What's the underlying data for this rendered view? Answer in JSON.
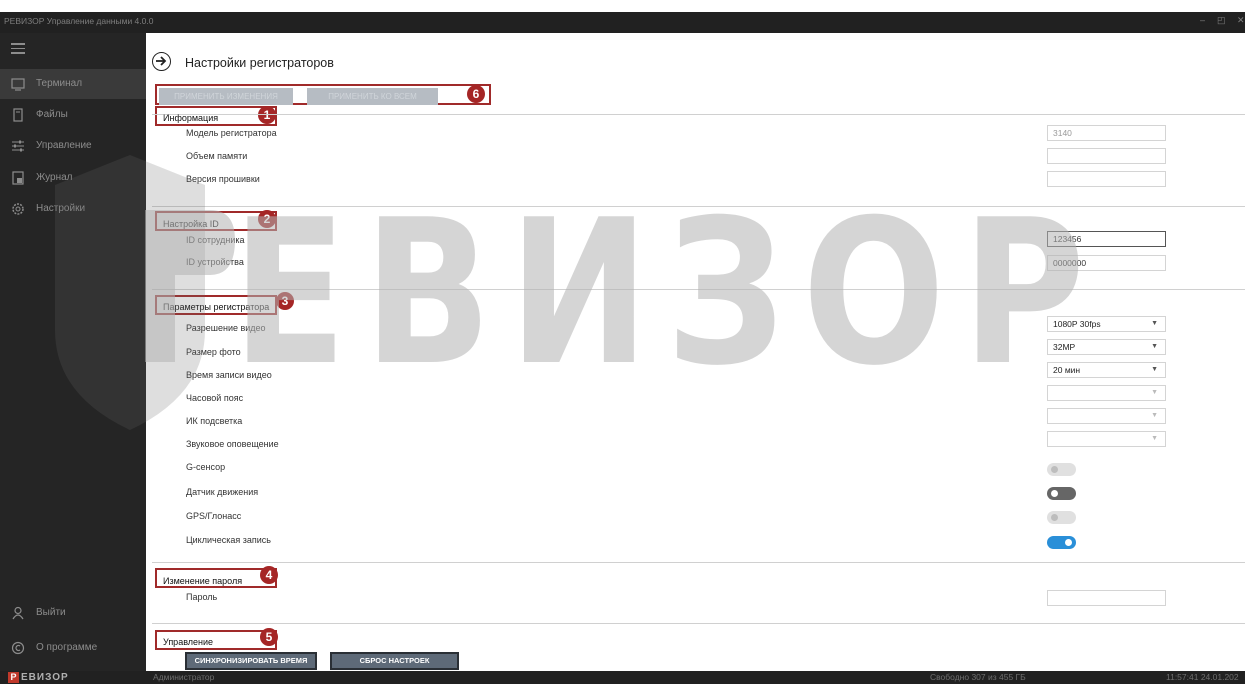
{
  "window": {
    "title": "РЕВИЗОР Управление данными 4.0.0",
    "controls": [
      "–",
      "◰",
      "✕"
    ]
  },
  "sidebar": {
    "items": [
      {
        "label": "Терминал",
        "icon": "terminal-icon"
      },
      {
        "label": "Файлы",
        "icon": "files-icon"
      },
      {
        "label": "Управление",
        "icon": "sliders-icon"
      },
      {
        "label": "Журнал",
        "icon": "journal-icon"
      },
      {
        "label": "Настройки",
        "icon": "gear-icon"
      }
    ],
    "bottom": [
      {
        "label": "Выйти",
        "icon": "user-icon"
      },
      {
        "label": "О программе",
        "icon": "copyright-icon"
      }
    ]
  },
  "page": {
    "title": "Настройки регистраторов"
  },
  "actions": {
    "apply": "ПРИМЕНИТЬ ИЗМЕНЕНИЯ",
    "apply_all": "ПРИМЕНИТЬ КО ВСЕМ"
  },
  "badges": [
    "1",
    "2",
    "3",
    "4",
    "5",
    "6"
  ],
  "info": {
    "title": "Информация",
    "model_label": "Модель регистратора",
    "model_value": "3140",
    "memory_label": "Объем памяти",
    "memory_value": "",
    "firmware_label": "Версия прошивки",
    "firmware_value": ""
  },
  "id_settings": {
    "title": "Настройка ID",
    "employee_label": "ID сотрудника",
    "employee_value": "123456",
    "device_label": "ID устройства",
    "device_value": "0000000"
  },
  "recorder_params": {
    "title": "Параметры регистратора",
    "video_res_label": "Разрешение видео",
    "video_res_value": "1080P 30fps",
    "photo_size_label": "Размер фото",
    "photo_size_value": "32MP",
    "rec_time_label": "Время записи видео",
    "rec_time_value": "20 мин",
    "timezone_label": "Часовой пояс",
    "timezone_value": "",
    "ir_label": "ИК подсветка",
    "ir_value": "",
    "sound_label": "Звуковое оповещение",
    "sound_value": "",
    "gsensor_label": "G-сенсор",
    "motion_label": "Датчик движения",
    "gps_label": "GPS/Глонасс",
    "cyclic_label": "Циклическая запись"
  },
  "toggles": {
    "gsensor": false,
    "motion": false,
    "gps": false,
    "cyclic": true
  },
  "password": {
    "title": "Изменение пароля",
    "label": "Пароль",
    "value": ""
  },
  "control": {
    "title": "Управление",
    "sync_time": "СИНХРОНИЗИРОВАТЬ ВРЕМЯ",
    "reset": "СБРОС НАСТРОЕК"
  },
  "status": {
    "logo_letter": "Р",
    "logo_text": "ЕВИЗОР",
    "user": "Администратор",
    "free_space": "Свободно 307 из 455 ГБ",
    "datetime": "11:57:41 24.01.202"
  },
  "watermark": {
    "text": "ЕВИЗОР",
    "color": "#b3b3b3"
  },
  "colors": {
    "accent_red": "#a52626",
    "toggle_on": "#2a8fd8",
    "sidebar": "#252525"
  }
}
